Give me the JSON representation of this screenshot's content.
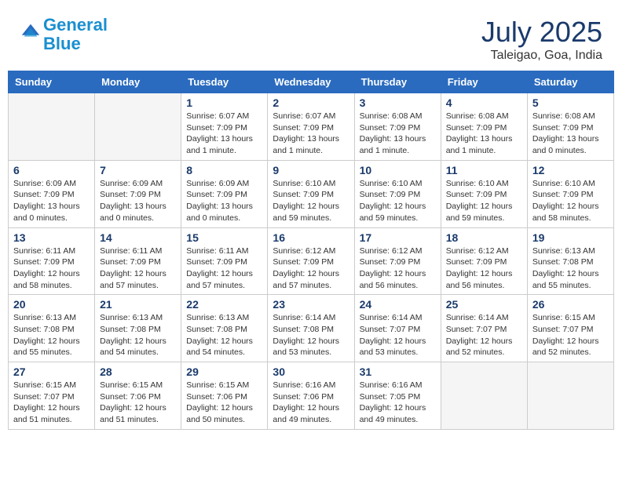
{
  "header": {
    "logo_line1": "General",
    "logo_line2": "Blue",
    "month": "July 2025",
    "location": "Taleigao, Goa, India"
  },
  "weekdays": [
    "Sunday",
    "Monday",
    "Tuesday",
    "Wednesday",
    "Thursday",
    "Friday",
    "Saturday"
  ],
  "weeks": [
    [
      {
        "day": "",
        "info": ""
      },
      {
        "day": "",
        "info": ""
      },
      {
        "day": "1",
        "info": "Sunrise: 6:07 AM\nSunset: 7:09 PM\nDaylight: 13 hours and 1 minute."
      },
      {
        "day": "2",
        "info": "Sunrise: 6:07 AM\nSunset: 7:09 PM\nDaylight: 13 hours and 1 minute."
      },
      {
        "day": "3",
        "info": "Sunrise: 6:08 AM\nSunset: 7:09 PM\nDaylight: 13 hours and 1 minute."
      },
      {
        "day": "4",
        "info": "Sunrise: 6:08 AM\nSunset: 7:09 PM\nDaylight: 13 hours and 1 minute."
      },
      {
        "day": "5",
        "info": "Sunrise: 6:08 AM\nSunset: 7:09 PM\nDaylight: 13 hours and 0 minutes."
      }
    ],
    [
      {
        "day": "6",
        "info": "Sunrise: 6:09 AM\nSunset: 7:09 PM\nDaylight: 13 hours and 0 minutes."
      },
      {
        "day": "7",
        "info": "Sunrise: 6:09 AM\nSunset: 7:09 PM\nDaylight: 13 hours and 0 minutes."
      },
      {
        "day": "8",
        "info": "Sunrise: 6:09 AM\nSunset: 7:09 PM\nDaylight: 13 hours and 0 minutes."
      },
      {
        "day": "9",
        "info": "Sunrise: 6:10 AM\nSunset: 7:09 PM\nDaylight: 12 hours and 59 minutes."
      },
      {
        "day": "10",
        "info": "Sunrise: 6:10 AM\nSunset: 7:09 PM\nDaylight: 12 hours and 59 minutes."
      },
      {
        "day": "11",
        "info": "Sunrise: 6:10 AM\nSunset: 7:09 PM\nDaylight: 12 hours and 59 minutes."
      },
      {
        "day": "12",
        "info": "Sunrise: 6:10 AM\nSunset: 7:09 PM\nDaylight: 12 hours and 58 minutes."
      }
    ],
    [
      {
        "day": "13",
        "info": "Sunrise: 6:11 AM\nSunset: 7:09 PM\nDaylight: 12 hours and 58 minutes."
      },
      {
        "day": "14",
        "info": "Sunrise: 6:11 AM\nSunset: 7:09 PM\nDaylight: 12 hours and 57 minutes."
      },
      {
        "day": "15",
        "info": "Sunrise: 6:11 AM\nSunset: 7:09 PM\nDaylight: 12 hours and 57 minutes."
      },
      {
        "day": "16",
        "info": "Sunrise: 6:12 AM\nSunset: 7:09 PM\nDaylight: 12 hours and 57 minutes."
      },
      {
        "day": "17",
        "info": "Sunrise: 6:12 AM\nSunset: 7:09 PM\nDaylight: 12 hours and 56 minutes."
      },
      {
        "day": "18",
        "info": "Sunrise: 6:12 AM\nSunset: 7:09 PM\nDaylight: 12 hours and 56 minutes."
      },
      {
        "day": "19",
        "info": "Sunrise: 6:13 AM\nSunset: 7:08 PM\nDaylight: 12 hours and 55 minutes."
      }
    ],
    [
      {
        "day": "20",
        "info": "Sunrise: 6:13 AM\nSunset: 7:08 PM\nDaylight: 12 hours and 55 minutes."
      },
      {
        "day": "21",
        "info": "Sunrise: 6:13 AM\nSunset: 7:08 PM\nDaylight: 12 hours and 54 minutes."
      },
      {
        "day": "22",
        "info": "Sunrise: 6:13 AM\nSunset: 7:08 PM\nDaylight: 12 hours and 54 minutes."
      },
      {
        "day": "23",
        "info": "Sunrise: 6:14 AM\nSunset: 7:08 PM\nDaylight: 12 hours and 53 minutes."
      },
      {
        "day": "24",
        "info": "Sunrise: 6:14 AM\nSunset: 7:07 PM\nDaylight: 12 hours and 53 minutes."
      },
      {
        "day": "25",
        "info": "Sunrise: 6:14 AM\nSunset: 7:07 PM\nDaylight: 12 hours and 52 minutes."
      },
      {
        "day": "26",
        "info": "Sunrise: 6:15 AM\nSunset: 7:07 PM\nDaylight: 12 hours and 52 minutes."
      }
    ],
    [
      {
        "day": "27",
        "info": "Sunrise: 6:15 AM\nSunset: 7:07 PM\nDaylight: 12 hours and 51 minutes."
      },
      {
        "day": "28",
        "info": "Sunrise: 6:15 AM\nSunset: 7:06 PM\nDaylight: 12 hours and 51 minutes."
      },
      {
        "day": "29",
        "info": "Sunrise: 6:15 AM\nSunset: 7:06 PM\nDaylight: 12 hours and 50 minutes."
      },
      {
        "day": "30",
        "info": "Sunrise: 6:16 AM\nSunset: 7:06 PM\nDaylight: 12 hours and 49 minutes."
      },
      {
        "day": "31",
        "info": "Sunrise: 6:16 AM\nSunset: 7:05 PM\nDaylight: 12 hours and 49 minutes."
      },
      {
        "day": "",
        "info": ""
      },
      {
        "day": "",
        "info": ""
      }
    ]
  ]
}
